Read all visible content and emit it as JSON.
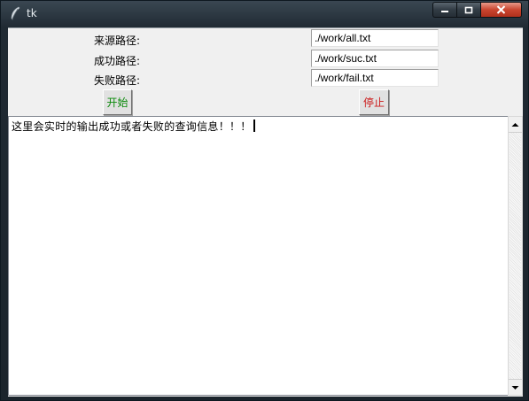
{
  "window": {
    "title": "tk"
  },
  "form": {
    "source_label": "来源路径:",
    "source_value": "./work/all.txt",
    "success_label": "成功路径:",
    "success_value": "./work/suc.txt",
    "fail_label": "失败路径:",
    "fail_value": "./work/fail.txt"
  },
  "buttons": {
    "start": "开始",
    "stop": "停止"
  },
  "output": {
    "text": "这里会实时的输出成功或者失败的查询信息！！！"
  },
  "colors": {
    "start_text": "#0b8a0b",
    "stop_text": "#cc1a1a",
    "close_button": "#c9452f"
  },
  "icons": [
    "feather-icon",
    "minimize-icon",
    "maximize-icon",
    "close-icon",
    "scroll-up-arrow-icon",
    "scroll-down-arrow-icon"
  ]
}
